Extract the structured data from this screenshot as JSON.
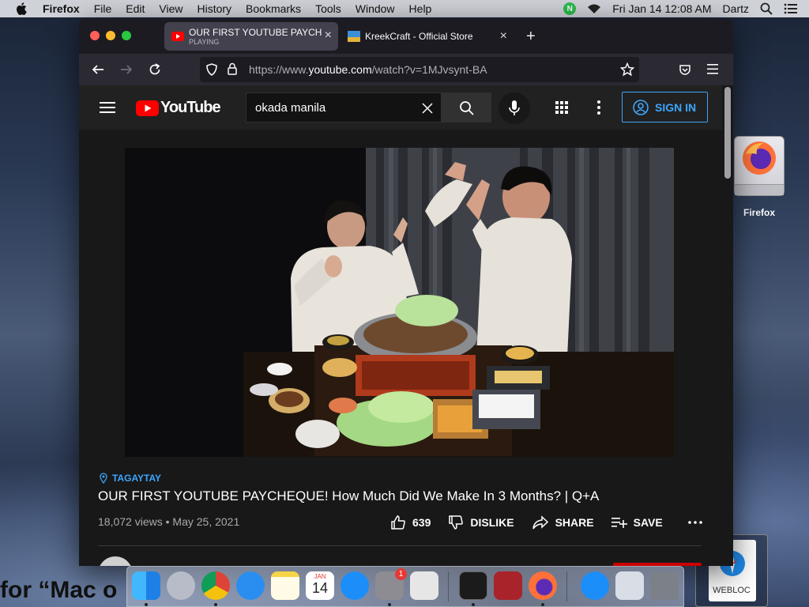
{
  "menubar": {
    "app": "Firefox",
    "items": [
      "File",
      "Edit",
      "View",
      "History",
      "Bookmarks",
      "Tools",
      "Window",
      "Help"
    ],
    "status_badge": "N",
    "clock": "Fri Jan 14  12:08 AM",
    "user": "Dartz"
  },
  "desktop": {
    "firefox_drive_label": "Firefox",
    "webloc_label": "WEBLOC",
    "finder_text": "for “Mac o"
  },
  "browser": {
    "tabs": [
      {
        "title": "OUR FIRST YOUTUBE PAYCHEQ",
        "subtitle": "PLAYING",
        "active": true
      },
      {
        "title": "KreekCraft - Official Store",
        "subtitle": "",
        "active": false
      }
    ],
    "url": {
      "prefix": "https://www.",
      "domain": "youtube.com",
      "path": "/watch?v=1MJvsynt-BA"
    }
  },
  "youtube": {
    "logo_text": "YouTube",
    "search_query": "okada manila",
    "sign_in": "SIGN IN",
    "video": {
      "location": "TAGAYTAY",
      "title": "OUR FIRST YOUTUBE PAYCHEQUE! How Much Did We Make In 3 Months? | Q+A",
      "views": "18,072 views",
      "date": "May 25, 2021",
      "likes": "639",
      "dislike_label": "DISLIKE",
      "share_label": "SHARE",
      "save_label": "SAVE"
    }
  },
  "dock": {
    "calendar_month": "JAN",
    "calendar_day": "14",
    "settings_badge": "1"
  },
  "colors": {
    "yt_red": "#ff0000",
    "yt_blue": "#3ea6ff",
    "firefox_tab_active": "#42414d"
  }
}
